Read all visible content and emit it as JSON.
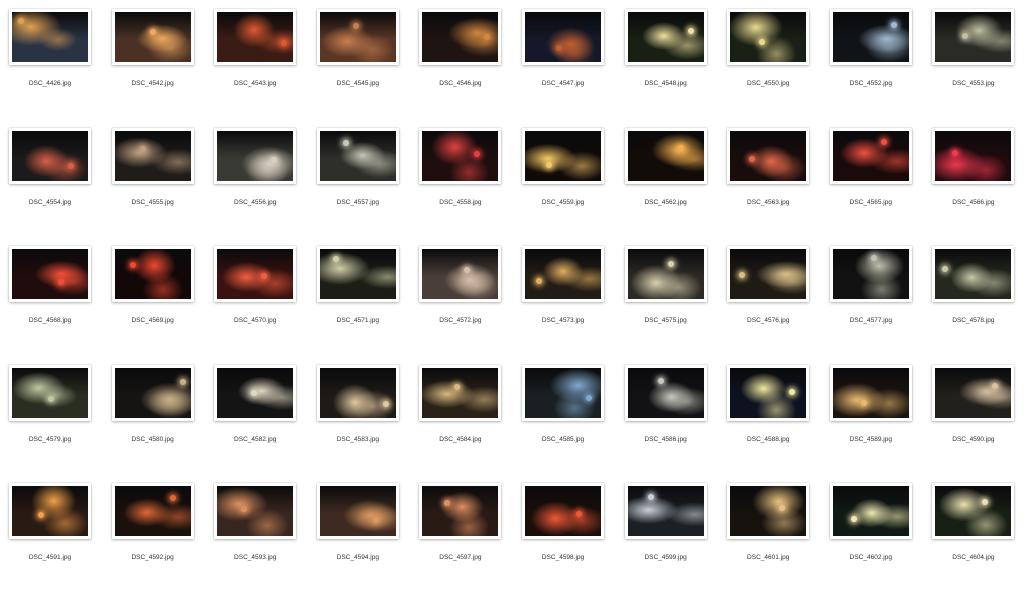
{
  "files": [
    {
      "name": "DSC_4426.jpg",
      "tone": "#2a3344",
      "glow": "#e0a050"
    },
    {
      "name": "DSC_4542.jpg",
      "tone": "#4a3124",
      "glow": "#f0a860"
    },
    {
      "name": "DSC_4543.jpg",
      "tone": "#3a1c14",
      "glow": "#e05a30"
    },
    {
      "name": "DSC_4545.jpg",
      "tone": "#5a3626",
      "glow": "#c88050"
    },
    {
      "name": "DSC_4546.jpg",
      "tone": "#1e1412",
      "glow": "#d08840"
    },
    {
      "name": "DSC_4547.jpg",
      "tone": "#14182a",
      "glow": "#c06030"
    },
    {
      "name": "DSC_4548.jpg",
      "tone": "#182014",
      "glow": "#f0e0a0"
    },
    {
      "name": "DSC_4550.jpg",
      "tone": "#1a2016",
      "glow": "#e8d890"
    },
    {
      "name": "DSC_4552.jpg",
      "tone": "#101418",
      "glow": "#a0b8d0"
    },
    {
      "name": "DSC_4553.jpg",
      "tone": "#2a2a26",
      "glow": "#c0c0a0"
    },
    {
      "name": "DSC_4554.jpg",
      "tone": "#1c1a1a",
      "glow": "#d86048"
    },
    {
      "name": "DSC_4555.jpg",
      "tone": "#201c1a",
      "glow": "#c0a080"
    },
    {
      "name": "DSC_4556.jpg",
      "tone": "#3a3a34",
      "glow": "#d8d0c0"
    },
    {
      "name": "DSC_4557.jpg",
      "tone": "#2e2e2a",
      "glow": "#c8c8b8"
    },
    {
      "name": "DSC_4558.jpg",
      "tone": "#1e0e0e",
      "glow": "#e04040"
    },
    {
      "name": "DSC_4559.jpg",
      "tone": "#100a08",
      "glow": "#f4c868"
    },
    {
      "name": "DSC_4562.jpg",
      "tone": "#120c08",
      "glow": "#f4b050"
    },
    {
      "name": "DSC_4563.jpg",
      "tone": "#180c0c",
      "glow": "#e06848"
    },
    {
      "name": "DSC_4565.jpg",
      "tone": "#1a0a0a",
      "glow": "#f05040"
    },
    {
      "name": "DSC_4566.jpg",
      "tone": "#200a0e",
      "glow": "#f03850"
    },
    {
      "name": "DSC_4568.jpg",
      "tone": "#200c0c",
      "glow": "#f05038"
    },
    {
      "name": "DSC_4569.jpg",
      "tone": "#120808",
      "glow": "#f04830"
    },
    {
      "name": "DSC_4570.jpg",
      "tone": "#3a1210",
      "glow": "#f06040"
    },
    {
      "name": "DSC_4571.jpg",
      "tone": "#1c1e16",
      "glow": "#d0d0a8"
    },
    {
      "name": "DSC_4572.jpg",
      "tone": "#4a3e38",
      "glow": "#d8c0a8"
    },
    {
      "name": "DSC_4573.jpg",
      "tone": "#221c16",
      "glow": "#e0b060"
    },
    {
      "name": "DSC_4575.jpg",
      "tone": "#2c2a24",
      "glow": "#d8d0b0"
    },
    {
      "name": "DSC_4576.jpg",
      "tone": "#1e1a14",
      "glow": "#d8c088"
    },
    {
      "name": "DSC_4577.jpg",
      "tone": "#121212",
      "glow": "#c0c0b0"
    },
    {
      "name": "DSC_4578.jpg",
      "tone": "#24281e",
      "glow": "#c8c8a8"
    },
    {
      "name": "DSC_4579.jpg",
      "tone": "#2a2e22",
      "glow": "#c0c8a0"
    },
    {
      "name": "DSC_4580.jpg",
      "tone": "#161412",
      "glow": "#c8b088"
    },
    {
      "name": "DSC_4582.jpg",
      "tone": "#141414",
      "glow": "#e0d8c0"
    },
    {
      "name": "DSC_4583.jpg",
      "tone": "#1e1a16",
      "glow": "#e0c8a0"
    },
    {
      "name": "DSC_4584.jpg",
      "tone": "#2a2218",
      "glow": "#d8b880"
    },
    {
      "name": "DSC_4585.jpg",
      "tone": "#1a2022",
      "glow": "#80a8d0"
    },
    {
      "name": "DSC_4586.jpg",
      "tone": "#121214",
      "glow": "#c8c8c0"
    },
    {
      "name": "DSC_4588.jpg",
      "tone": "#0e1220",
      "glow": "#f0e8a0"
    },
    {
      "name": "DSC_4589.jpg",
      "tone": "#1a1410",
      "glow": "#e8b870"
    },
    {
      "name": "DSC_4590.jpg",
      "tone": "#22201c",
      "glow": "#d8c0a0"
    },
    {
      "name": "DSC_4591.jpg",
      "tone": "#2a1a14",
      "glow": "#f0a048"
    },
    {
      "name": "DSC_4592.jpg",
      "tone": "#1a100c",
      "glow": "#e06838"
    },
    {
      "name": "DSC_4593.jpg",
      "tone": "#3a2620",
      "glow": "#d89060"
    },
    {
      "name": "DSC_4594.jpg",
      "tone": "#3e2a20",
      "glow": "#d89860"
    },
    {
      "name": "DSC_4597.jpg",
      "tone": "#2a1a16",
      "glow": "#e09060"
    },
    {
      "name": "DSC_4598.jpg",
      "tone": "#1a0e0a",
      "glow": "#f05838"
    },
    {
      "name": "DSC_4599.jpg",
      "tone": "#1a2024",
      "glow": "#c8d0d8"
    },
    {
      "name": "DSC_4601.jpg",
      "tone": "#16120e",
      "glow": "#e8c080"
    },
    {
      "name": "DSC_4602.jpg",
      "tone": "#101a14",
      "glow": "#f0e8b0"
    },
    {
      "name": "DSC_4604.jpg",
      "tone": "#182016",
      "glow": "#e8e0b0"
    }
  ]
}
